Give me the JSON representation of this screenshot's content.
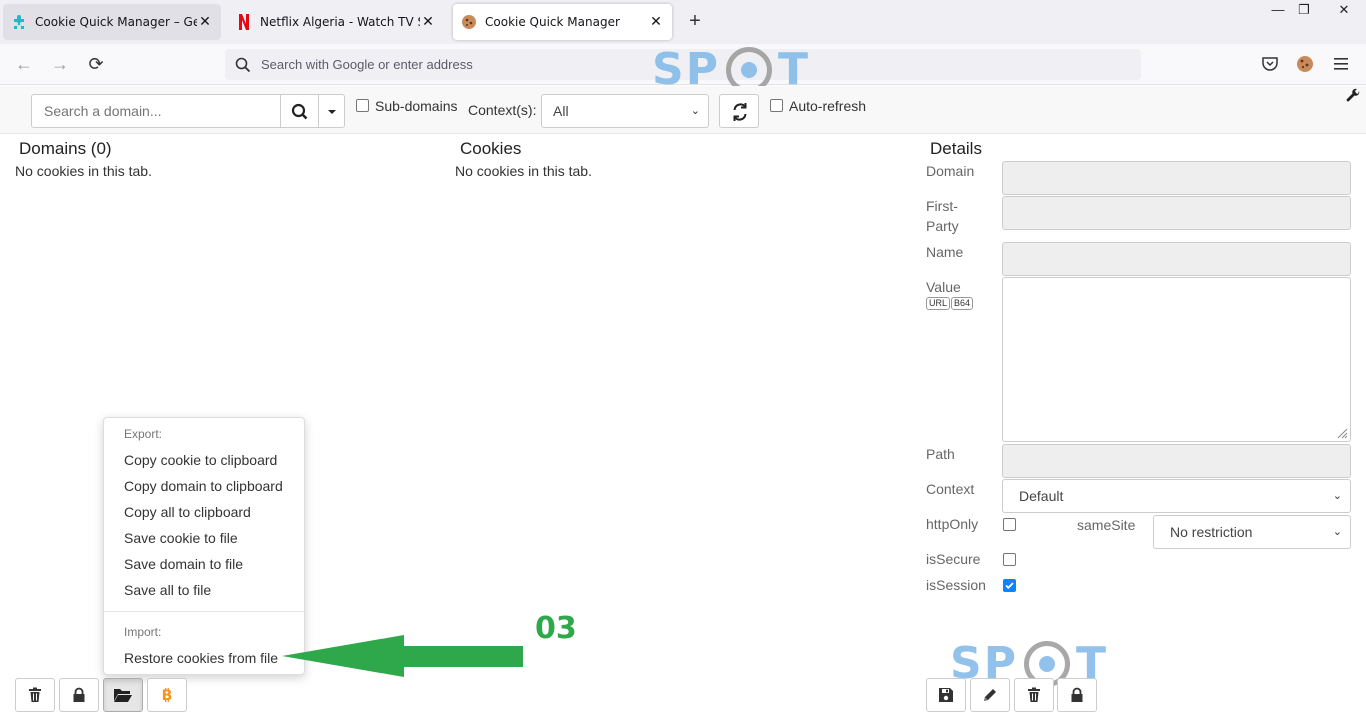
{
  "tabs": [
    {
      "title": "Cookie Quick Manager – Get th",
      "icon": "puzzle-icon"
    },
    {
      "title": "Netflix Algeria - Watch TV Show",
      "icon": "netflix-icon"
    },
    {
      "title": "Cookie Quick Manager",
      "icon": "cookie-icon"
    }
  ],
  "navbar": {
    "url_placeholder": "Search with Google or enter address"
  },
  "toolbar": {
    "search_placeholder": "Search a domain...",
    "subdomains_label": "Sub-domains",
    "contexts_label": "Context(s):",
    "contexts_value": "All",
    "autorefresh_label": "Auto-refresh"
  },
  "domains": {
    "heading": "Domains (0)",
    "empty": "No cookies in this tab."
  },
  "cookies": {
    "heading": "Cookies",
    "empty": "No cookies in this tab."
  },
  "details": {
    "heading": "Details",
    "domain_label": "Domain",
    "firstparty_label": "First-Party",
    "name_label": "Name",
    "value_label": "Value",
    "url_badge": "URL",
    "b64_badge": "B64",
    "path_label": "Path",
    "context_label": "Context",
    "context_value": "Default",
    "httponly_label": "httpOnly",
    "samesite_label": "sameSite",
    "samesite_value": "No restriction",
    "issecure_label": "isSecure",
    "issession_label": "isSession",
    "issession_checked": true
  },
  "menu": {
    "export_header": "Export:",
    "export_items": [
      "Copy cookie to clipboard",
      "Copy domain to clipboard",
      "Copy all to clipboard",
      "Save cookie to file",
      "Save domain to file",
      "Save all to file"
    ],
    "import_header": "Import:",
    "import_items": [
      "Restore cookies from file"
    ]
  },
  "annotation": {
    "step": "03",
    "arrow_color": "#2ea84a"
  },
  "watermark": {
    "left": "SP",
    "right": "T"
  },
  "colors": {
    "accent": "#0a84ff",
    "bitcoin": "#f7931a"
  }
}
